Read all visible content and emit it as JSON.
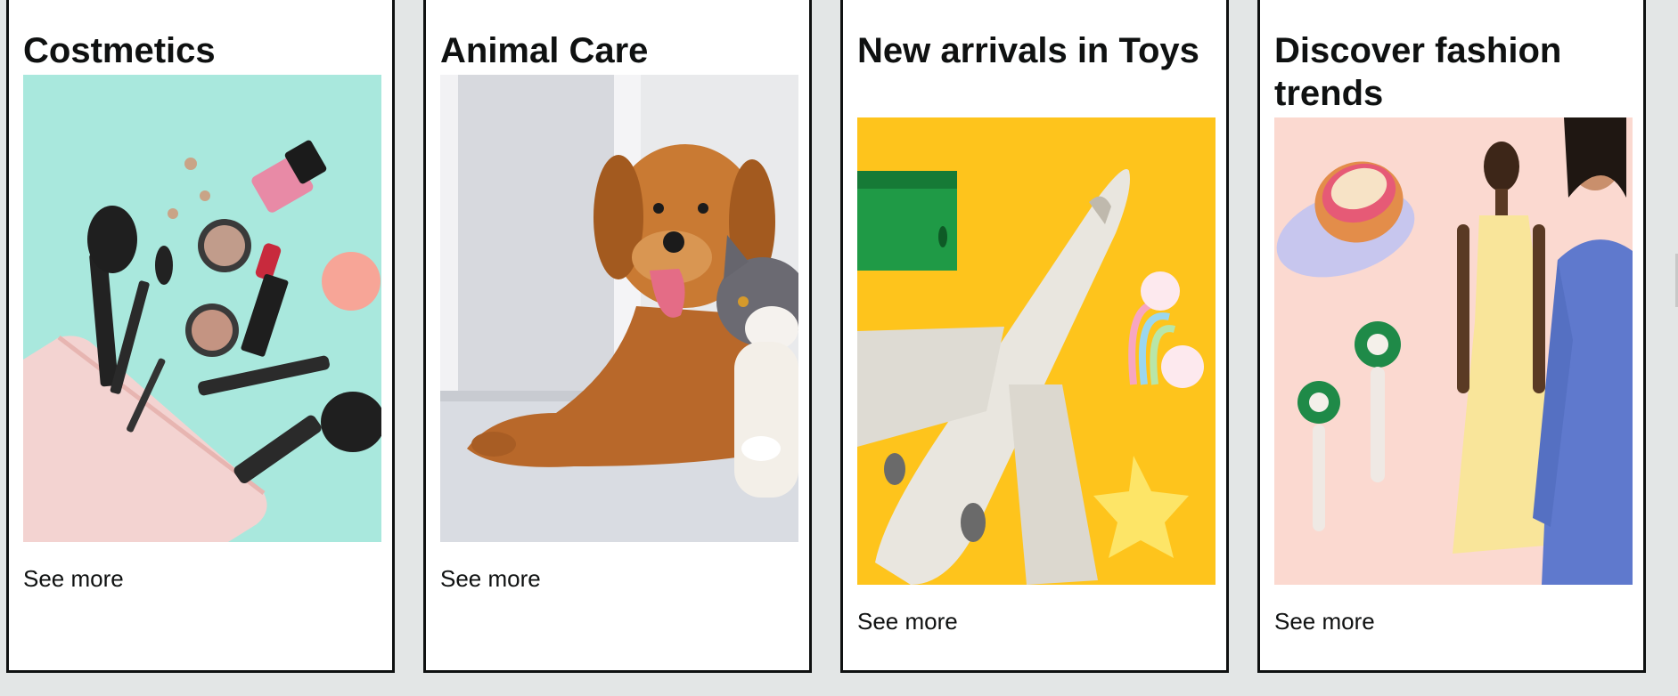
{
  "cards": [
    {
      "title": "Costmetics",
      "image_label": "cosmetics products on turquoise background",
      "link": "See more"
    },
    {
      "title": "Animal Care",
      "image_label": "golden retriever and grey cat lying on floor",
      "link": "See more"
    },
    {
      "title": "New arrivals in Toys",
      "image_label": "toy airplane on yellow background",
      "link": "See more"
    },
    {
      "title": "Discover fashion trends",
      "image_label": "fashion models with hat and earrings",
      "link": "See more"
    }
  ],
  "colors": {
    "page_bg": "#e3e6e6",
    "card_bg": "#ffffff",
    "text": "#0f1111",
    "cosmetics_bg": "#a9e8dd",
    "toys_bg": "#fec41c",
    "fashion_bg": "#fbd9d0"
  }
}
